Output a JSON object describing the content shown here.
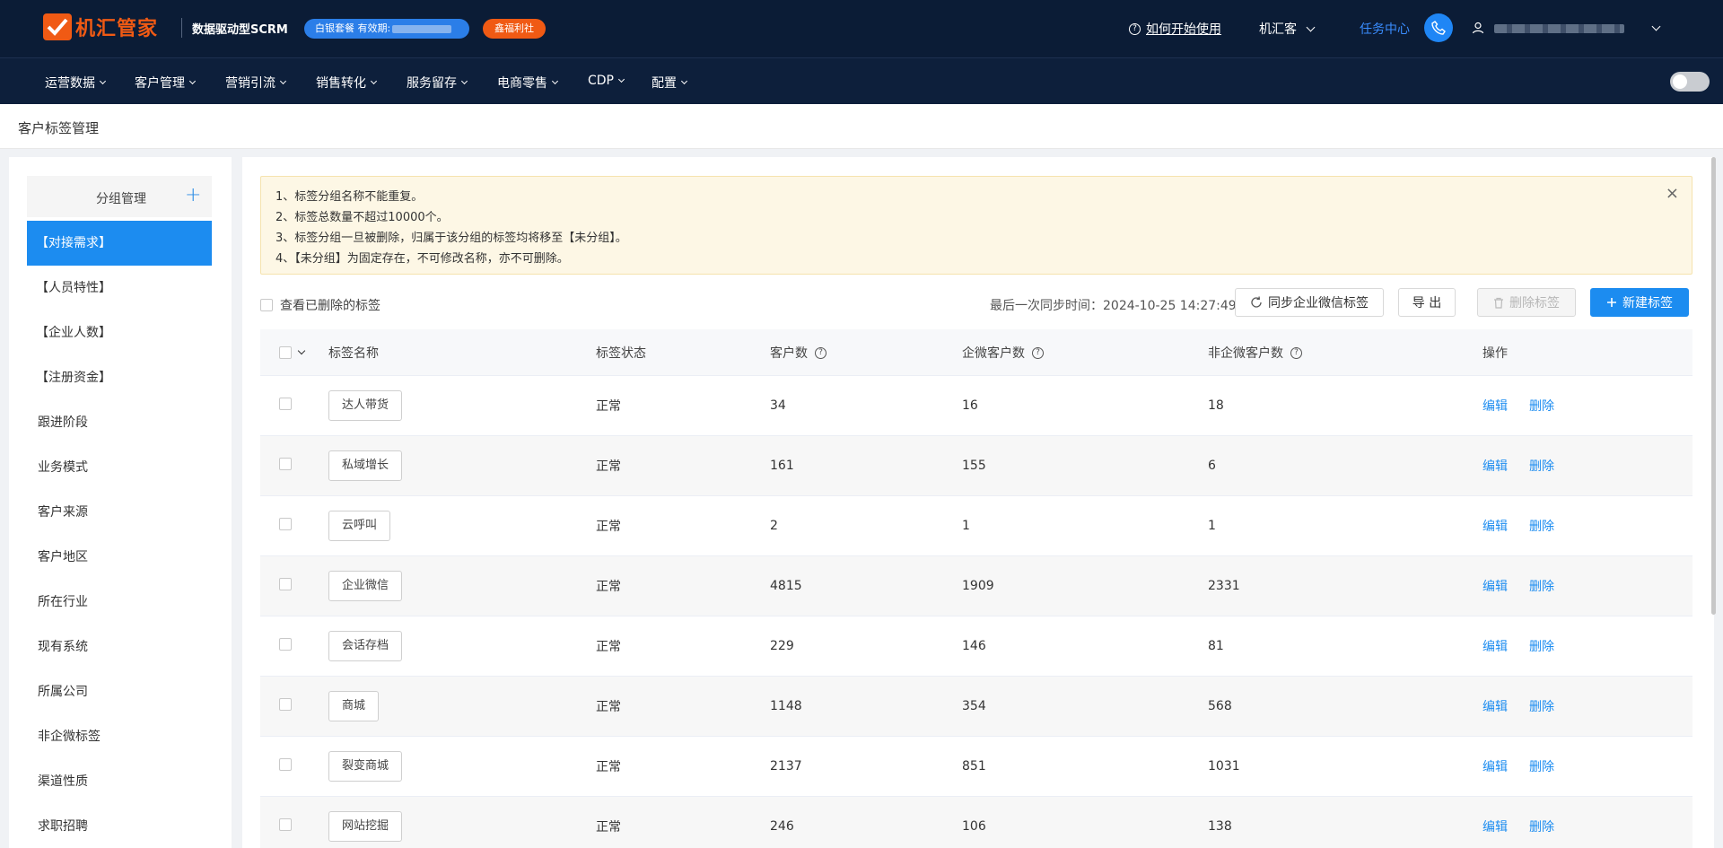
{
  "header": {
    "logo_text": "机汇管家",
    "slogan": "数据驱动型SCRM",
    "plan_badge": "白银套餐 有效期:",
    "welfare_badge": "鑫福利社",
    "help_link": "如何开始使用",
    "org_name": "机汇客",
    "task_center": "任务中心"
  },
  "menu": [
    "运营数据",
    "客户管理",
    "营销引流",
    "销售转化",
    "服务留存",
    "电商零售",
    "CDP",
    "配置"
  ],
  "page_title": "客户标签管理",
  "groups": {
    "header_label": "分组管理",
    "items": [
      "【对接需求】",
      "【人员特性】",
      "【企业人数】",
      "【注册资金】",
      "跟进阶段",
      "业务模式",
      "客户来源",
      "客户地区",
      "所在行业",
      "现有系统",
      "所属公司",
      "非企微标签",
      "渠道性质",
      "求职招聘"
    ]
  },
  "notice": {
    "lines": [
      "1、标签分组名称不能重复。",
      "2、标签总数量不超过10000个。",
      "3、标签分组一旦被删除，归属于该分组的标签均将移至【未分组】。",
      "4、【未分组】为固定存在，不可修改名称，亦不可删除。"
    ],
    "close": "×"
  },
  "toolbar": {
    "show_deleted": "查看已删除的标签",
    "last_sync_label": "最后一次同步时间：",
    "last_sync_time": "2024-10-25 14:27:49",
    "sync_button": "同步企业微信标签",
    "export_button": "导 出",
    "delete_button": "删除标签",
    "new_button": "新建标签"
  },
  "table": {
    "headers": {
      "name": "标签名称",
      "status": "标签状态",
      "customers": "客户数",
      "wecom_customers": "企微客户数",
      "non_wecom_customers": "非企微客户数",
      "actions": "操作"
    },
    "edit_label": "编辑",
    "delete_label": "删除",
    "rows": [
      {
        "name": "达人带货",
        "status": "正常",
        "customers": "34",
        "wecom": "16",
        "non_wecom": "18"
      },
      {
        "name": "私域增长",
        "status": "正常",
        "customers": "161",
        "wecom": "155",
        "non_wecom": "6"
      },
      {
        "name": "云呼叫",
        "status": "正常",
        "customers": "2",
        "wecom": "1",
        "non_wecom": "1"
      },
      {
        "name": "企业微信",
        "status": "正常",
        "customers": "4815",
        "wecom": "1909",
        "non_wecom": "2331"
      },
      {
        "name": "会话存档",
        "status": "正常",
        "customers": "229",
        "wecom": "146",
        "non_wecom": "81"
      },
      {
        "name": "商城",
        "status": "正常",
        "customers": "1148",
        "wecom": "354",
        "non_wecom": "568"
      },
      {
        "name": "裂变商城",
        "status": "正常",
        "customers": "2137",
        "wecom": "851",
        "non_wecom": "1031"
      },
      {
        "name": "网站挖掘",
        "status": "正常",
        "customers": "246",
        "wecom": "106",
        "non_wecom": "138"
      }
    ]
  },
  "colors": {
    "header_bg": "#0b1c36",
    "brand_orange": "#f05a14",
    "primary_blue": "#1c8cf0",
    "notice_bg": "#fdf7e5"
  }
}
